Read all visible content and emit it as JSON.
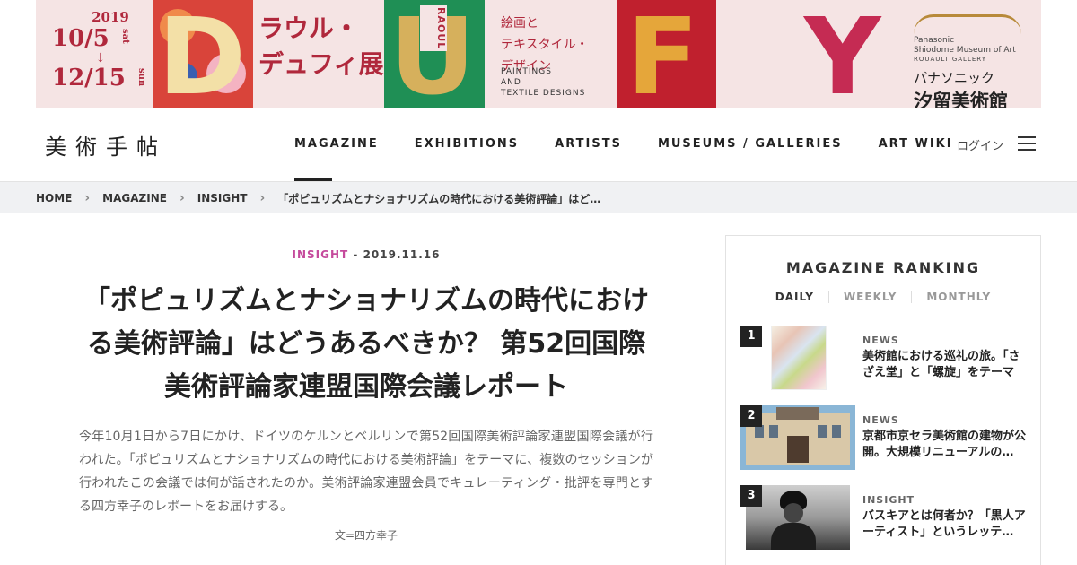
{
  "banner": {
    "year": "2019",
    "start": "10/5",
    "start_dow": "sat",
    "arrow": "↓",
    "end": "12/15",
    "end_dow": "sun",
    "letter_d": "D",
    "title_line1": "ラウル・",
    "title_line2": "デュフィ展",
    "letter_u": "U",
    "raoul": "RAOUL",
    "subtitle_line1": "絵画と",
    "subtitle_line2": "テキスタイル・",
    "subtitle_line3": "デザイン",
    "subtitle_en1": "PAINTINGS",
    "subtitle_en2": "AND",
    "subtitle_en3": "TEXTILE DESIGNS",
    "letter_f": "F",
    "letter_y": "Y",
    "museum_en1": "Panasonic",
    "museum_en2": "Shiodome Museum of Art",
    "museum_en3": "ROUAULT GALLERY",
    "museum_jp1": "パナソニック",
    "museum_jp2": "汐留美術館"
  },
  "header": {
    "logo": "美術手帖",
    "nav": [
      "MAGAZINE",
      "EXHIBITIONS",
      "ARTISTS",
      "MUSEUMS / GALLERIES",
      "ART WIKI"
    ],
    "login": "ログイン"
  },
  "breadcrumb": [
    "HOME",
    "MAGAZINE",
    "INSIGHT",
    "「ポピュリズムとナショナリズムの時代における美術評論」はど…"
  ],
  "article": {
    "category": "INSIGHT",
    "separator": " - ",
    "date": "2019.11.16",
    "title": "「ポピュリズムとナショナリズムの時代における美術評論」はどうあるべきか？ 第52回国際美術評論家連盟国際会議レポート",
    "lead": "今年10月1日から7日にかけ、ドイツのケルンとベルリンで第52回国際美術評論家連盟国際会議が行われた。「ポピュリズムとナショナリズムの時代における美術評論」をテーマに、複数のセッションが行われたこの会議では何が話されたのか。美術評論家連盟会員でキュレーティング・批評を専門とする四方幸子のレポートをお届けする。",
    "credit": "文=四方幸子"
  },
  "ranking": {
    "title": "MAGAZINE RANKING",
    "tabs": [
      "DAILY",
      "WEEKLY",
      "MONTHLY"
    ],
    "items": [
      {
        "rank": "1",
        "category": "NEWS",
        "title": "美術館における巡礼の旅。「さざえ堂」と「螺旋」をテーマに…"
      },
      {
        "rank": "2",
        "category": "NEWS",
        "title": "京都市京セラ美術館の建物が公開。大規模リニューアルの…"
      },
      {
        "rank": "3",
        "category": "INSIGHT",
        "title": "バスキアとは何者か？「黒人アーティスト」というレッテ…"
      }
    ]
  }
}
